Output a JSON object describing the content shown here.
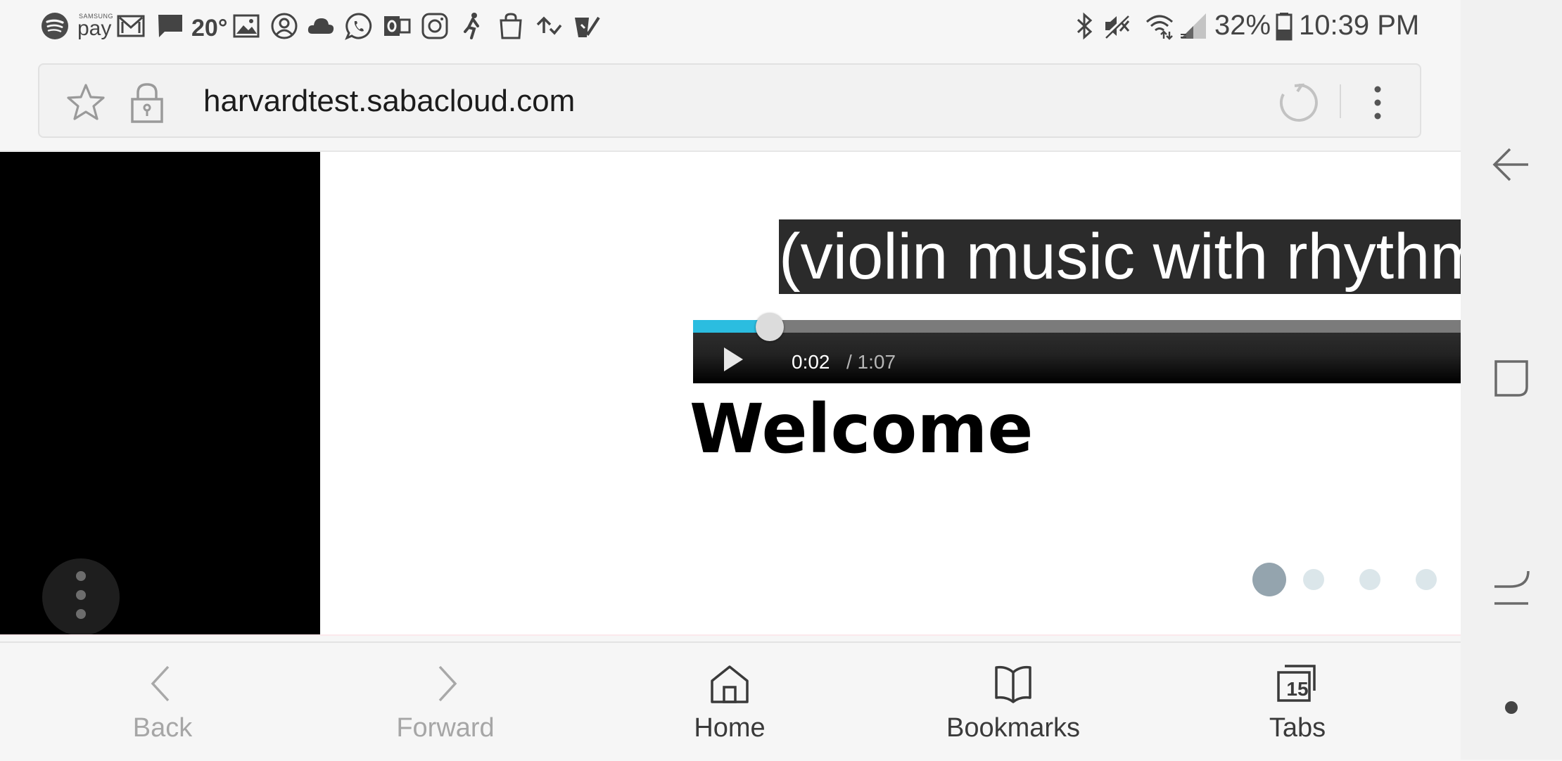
{
  "status_bar": {
    "samsung_pay_top": "SAMSUNG",
    "samsung_pay_bottom": "pay",
    "temperature": "20°",
    "battery_percent": "32%",
    "time": "10:39 PM",
    "icons": [
      "spotify-icon",
      "samsung-pay-icon",
      "gmail-icon",
      "message-icon",
      "weather-temperature",
      "gallery-icon",
      "account-icon",
      "cloud-icon",
      "whatsapp-icon",
      "outlook-icon",
      "instagram-icon",
      "fitness-icon",
      "shopping-bag-icon",
      "sync-check-icon",
      "checklist-icon",
      "bluetooth-icon",
      "mute-icon",
      "wifi-icon",
      "signal-icon",
      "battery-icon"
    ]
  },
  "browser": {
    "url": "harvardtest.sabacloud.com"
  },
  "video": {
    "caption": "(violin music with rhythmic",
    "current_time": "0:02",
    "total_time": "/ 1:07",
    "progress_fraction": 0.03,
    "accent_color": "#2bbde0"
  },
  "page": {
    "heading": "Welcome",
    "carousel": {
      "total": 4,
      "active_index": 0
    }
  },
  "toolbar": {
    "back_label": "Back",
    "forward_label": "Forward",
    "home_label": "Home",
    "bookmarks_label": "Bookmarks",
    "tabs_label": "Tabs",
    "tabs_count": "15"
  }
}
